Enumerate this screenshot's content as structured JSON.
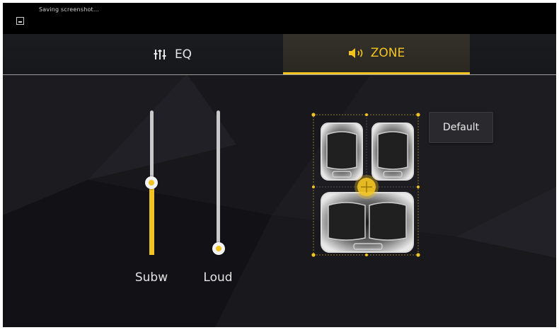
{
  "status_bar": {
    "notification_icon": "screenshot-icon",
    "text": "Saving screenshot..."
  },
  "tabs": [
    {
      "label": "EQ",
      "icon": "equalizer-icon",
      "selected": false
    },
    {
      "label": "ZONE",
      "icon": "speaker-icon",
      "selected": true
    }
  ],
  "sliders": [
    {
      "label": "Subw",
      "level": 0.51
    },
    {
      "label": "Loud",
      "level": 0.0
    }
  ],
  "default_button": {
    "label": "Default"
  },
  "zone": {
    "focus": "center",
    "seats": [
      "front-left",
      "front-right",
      "rear-bench"
    ]
  },
  "colors": {
    "accent": "#f2c422",
    "background": "#141418",
    "status_bar": "#000000",
    "text": "#e6e6e6"
  }
}
